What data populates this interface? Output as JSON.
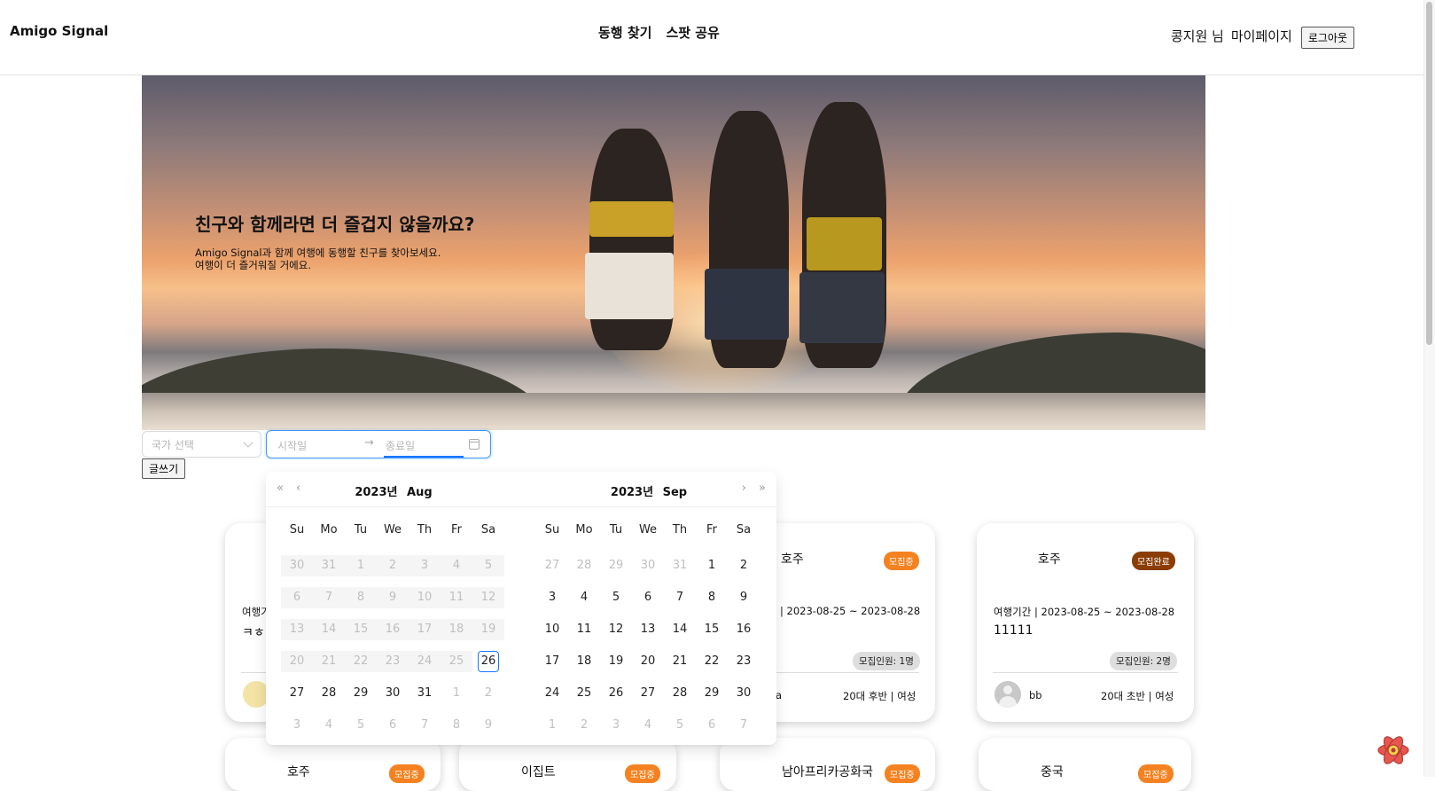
{
  "header": {
    "logo": "Amigo Signal",
    "nav": [
      "동행 찾기",
      "스팟 공유"
    ],
    "user_name": "콩지원 님",
    "mypage": "마이페이지",
    "logout": "로그아웃"
  },
  "hero": {
    "title": "친구와 함께라면 더 즐겁지 않을까요?",
    "sub1": "Amigo Signal과 함께 여행에 동행할 친구를 찾아보세요.",
    "sub2": "여행이 더 즐거워질 거에요."
  },
  "filters": {
    "country_placeholder": "국가 선택",
    "start_placeholder": "시작일",
    "arrow": "→",
    "end_placeholder": "종료일",
    "write_button": "글쓰기"
  },
  "calendar": {
    "nav": {
      "prev_year": "«",
      "prev_month": "‹",
      "next_month": "›",
      "next_year": "»"
    },
    "left": {
      "year": "2023년",
      "month": "Aug"
    },
    "right": {
      "year": "2023년",
      "month": "Sep"
    },
    "weekdays": [
      "Su",
      "Mo",
      "Tu",
      "We",
      "Th",
      "Fr",
      "Sa"
    ],
    "left_weeks": [
      [
        "30",
        "31",
        "1",
        "2",
        "3",
        "4",
        "5"
      ],
      [
        "6",
        "7",
        "8",
        "9",
        "10",
        "11",
        "12"
      ],
      [
        "13",
        "14",
        "15",
        "16",
        "17",
        "18",
        "19"
      ],
      [
        "20",
        "21",
        "22",
        "23",
        "24",
        "25",
        "26"
      ],
      [
        "27",
        "28",
        "29",
        "30",
        "31",
        "1",
        "2"
      ],
      [
        "3",
        "4",
        "5",
        "6",
        "7",
        "8",
        "9"
      ]
    ],
    "right_weeks": [
      [
        "27",
        "28",
        "29",
        "30",
        "31",
        "1",
        "2"
      ],
      [
        "3",
        "4",
        "5",
        "6",
        "7",
        "8",
        "9"
      ],
      [
        "10",
        "11",
        "12",
        "13",
        "14",
        "15",
        "16"
      ],
      [
        "17",
        "18",
        "19",
        "20",
        "21",
        "22",
        "23"
      ],
      [
        "24",
        "25",
        "26",
        "27",
        "28",
        "29",
        "30"
      ],
      [
        "1",
        "2",
        "3",
        "4",
        "5",
        "6",
        "7"
      ]
    ],
    "today": "26"
  },
  "cards": [
    {
      "period": "여행기",
      "content": "ㅋㅎ"
    },
    {
      "country": "호주",
      "status": "모집중",
      "period": "| 2023-08-25 ~ 2023-08-28",
      "members": "모집인원: 1명",
      "author": "a",
      "demo": "20대 후반 | 여성"
    },
    {
      "country": "호주",
      "status": "모집완료",
      "period": "여행기간 | 2023-08-25 ~ 2023-08-28",
      "content": "11111",
      "members": "모집인원: 2명",
      "author": "bb",
      "demo": "20대 초반 | 여성"
    }
  ],
  "bottom_cards": [
    {
      "country": "호주",
      "status": "모집중"
    },
    {
      "country": "이집트",
      "status": "모집중"
    },
    {
      "country": "남아프리카공화국",
      "status": "모집중"
    },
    {
      "country": "중국",
      "status": "모집중"
    }
  ],
  "colors": {
    "accent": "#1677ff",
    "badge_open": "#f58220",
    "badge_done": "#8a3d05"
  }
}
